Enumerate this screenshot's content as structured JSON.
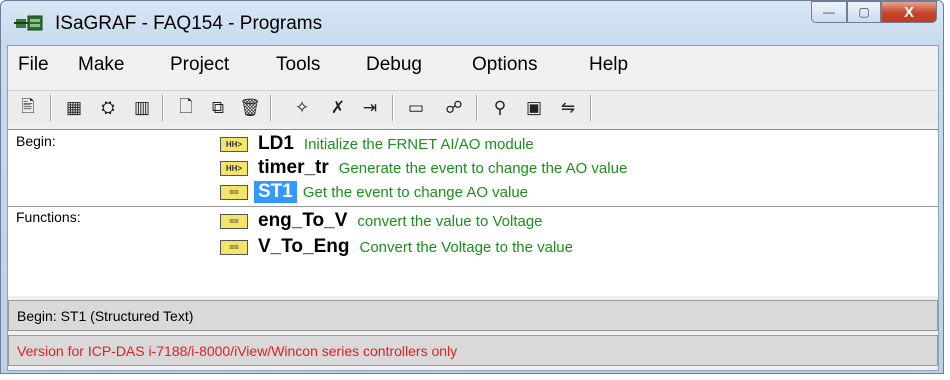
{
  "window": {
    "title": "ISaGRAF - FAQ154 - Programs"
  },
  "caption_buttons": {
    "minimize": "—",
    "maximize": "▢",
    "close": "X"
  },
  "menu": [
    "File",
    "Make",
    "Project",
    "Tools",
    "Debug",
    "Options",
    "Help"
  ],
  "toolbar_icons": [
    "page-icon",
    "library-icon",
    "dictionary-icon",
    "variables-icon",
    "new-file-icon",
    "copy-icon",
    "delete-icon",
    "verify-icon",
    "compile-icon",
    "link-icon",
    "io-connection-icon",
    "debug-icon",
    "simulate-icon",
    "monitor-icon",
    "transfer-icon"
  ],
  "sections": {
    "begin": {
      "label": "Begin:",
      "programs": [
        {
          "icon": "ld-icon",
          "icon_text": "HH>",
          "name": "LD1",
          "desc": "Initialize the FRNET AI/AO module",
          "selected": false
        },
        {
          "icon": "ld-icon",
          "icon_text": "HH>",
          "name": "timer_tr",
          "desc": "Generate the event to change the AO value",
          "selected": false
        },
        {
          "icon": "st-icon",
          "icon_text": "==",
          "name": "ST1",
          "desc": "Get the event to change AO value",
          "selected": true
        }
      ]
    },
    "functions": {
      "label": "Functions:",
      "programs": [
        {
          "icon": "st-icon",
          "icon_text": "==",
          "name": "eng_To_V",
          "desc": "convert the value to Voltage",
          "selected": false
        },
        {
          "icon": "st-icon",
          "icon_text": "==",
          "name": "V_To_Eng",
          "desc": "Convert the Voltage to the value",
          "selected": false
        }
      ]
    }
  },
  "status": {
    "current": "Begin:  ST1   (Structured Text)",
    "version": "Version for ICP-DAS i-7188/i-8000/iView/Wincon series controllers only"
  },
  "colors": {
    "description_green": "#1c8f1c",
    "selection_blue": "#3399ff",
    "version_red": "#e02020"
  }
}
